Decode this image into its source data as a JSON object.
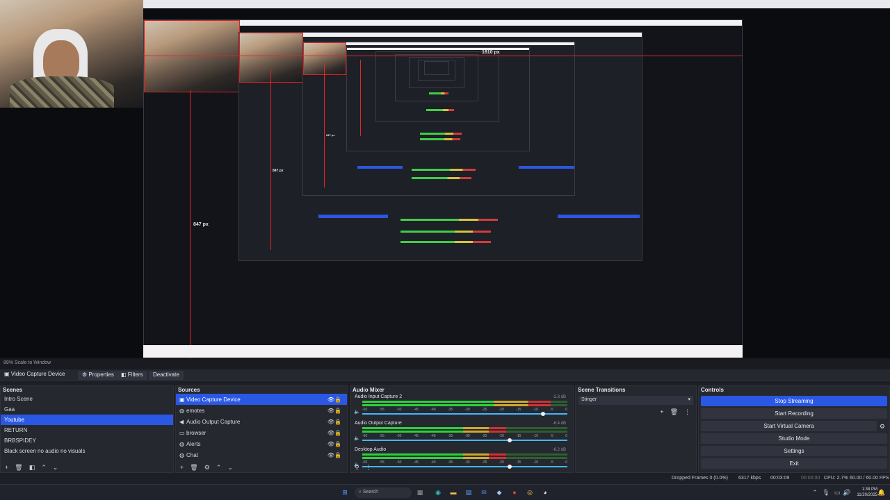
{
  "preview": {
    "px_labels": [
      "1610 px",
      "847 px",
      "847 px",
      "847 px"
    ]
  },
  "toolbar": {
    "zoom": "89%  Scale to Window"
  },
  "context_bar": {
    "source_name": "Video Capture Device",
    "properties": "Properties",
    "filters": "Filters",
    "deactivate": "Deactivate"
  },
  "scenes": {
    "title": "Scenes",
    "items": [
      "Intro Scene",
      "Gaa",
      "Youtube",
      "RETURN",
      "BRBSPIDEY",
      "Black screen no audio no visuals"
    ],
    "selected_index": 2
  },
  "sources": {
    "title": "Sources",
    "items": [
      {
        "label": "Video Capture Device",
        "icon": "camera-icon",
        "glyph": "▣"
      },
      {
        "label": "emotes",
        "icon": "globe-icon",
        "glyph": "◍"
      },
      {
        "label": "Audio Output Capture",
        "icon": "speaker-icon",
        "glyph": "◀"
      },
      {
        "label": "browser",
        "icon": "window-icon",
        "glyph": "▭"
      },
      {
        "label": "Alerts",
        "icon": "globe-icon",
        "glyph": "◍"
      },
      {
        "label": "Chat",
        "icon": "globe-icon",
        "glyph": "◍"
      }
    ]
  },
  "mixer": {
    "title": "Audio Mixer",
    "channels": [
      {
        "name": "Audio Input Capture 2",
        "db": "-2.3 dB",
        "level": 0.92,
        "fader": 0.88
      },
      {
        "name": "Audio Output Capture",
        "db": "-6.4 dB",
        "level": 0.7,
        "fader": 0.72
      },
      {
        "name": "Desktop Audio",
        "db": "-6.2 dB",
        "level": 0.7,
        "fader": 0.72
      }
    ],
    "ticks": [
      "-60",
      "-55",
      "-50",
      "-45",
      "-40",
      "-35",
      "-30",
      "-25",
      "-20",
      "-15",
      "-10",
      "-5",
      "0"
    ]
  },
  "transitions": {
    "title": "Scene Transitions",
    "selected": "Stinger"
  },
  "controls": {
    "title": "Controls",
    "buttons": [
      "Stop Streaming",
      "Start Recording",
      "Start Virtual Camera",
      "Studio Mode",
      "Settings",
      "Exit"
    ]
  },
  "status": {
    "dropped": "Dropped Frames 0 (0.0%)",
    "kbps": "6317 kbps",
    "live_time": "00:03:09",
    "rec_time": "00:00:00",
    "cpu": "CPU: 2.7%",
    "fps": "60.00 / 60.00 FPS"
  },
  "taskbar": {
    "search_placeholder": "Search",
    "time": "1:38 PM",
    "date": "11/20/2025"
  }
}
